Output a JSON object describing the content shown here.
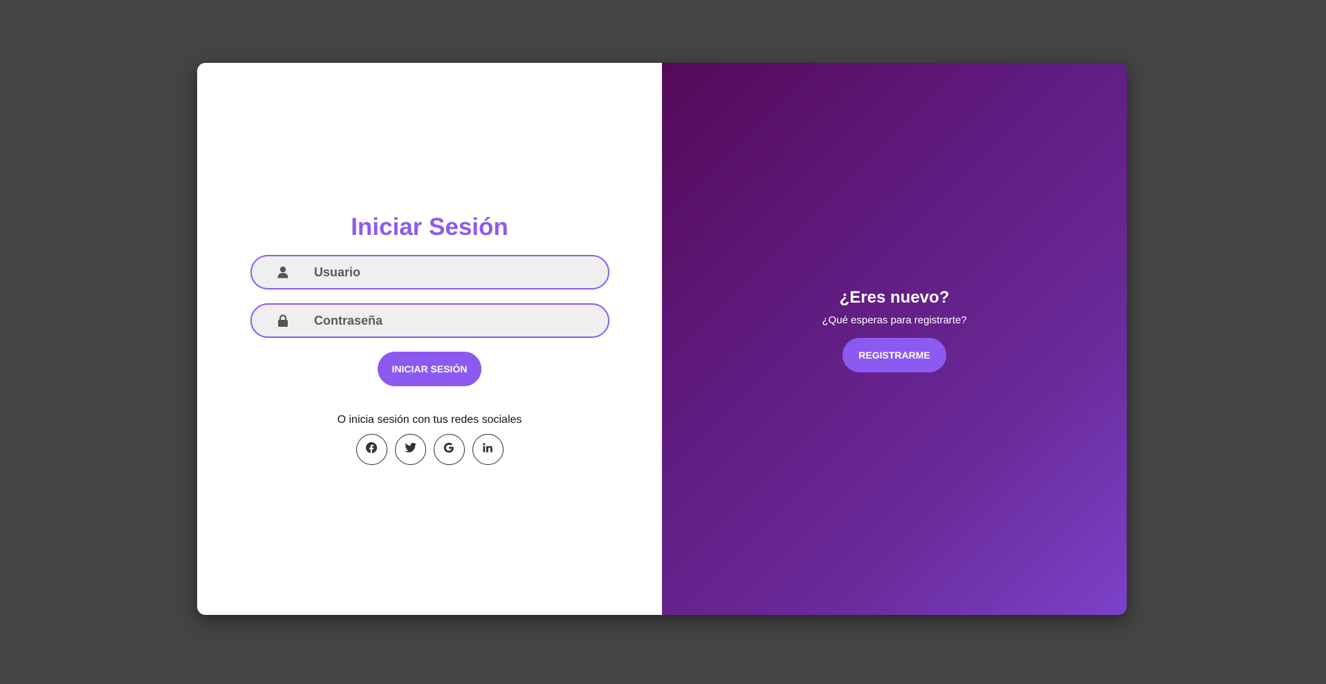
{
  "login": {
    "title": "Iniciar Sesión",
    "username_placeholder": "Usuario",
    "password_placeholder": "Contraseña",
    "submit_label": "INICIAR SESIÓN",
    "social_text": "O inicia sesión con tus redes sociales",
    "socials": [
      {
        "icon": "facebook-icon"
      },
      {
        "icon": "twitter-icon"
      },
      {
        "icon": "google-icon"
      },
      {
        "icon": "linkedin-icon"
      }
    ]
  },
  "register_panel": {
    "title": "¿Eres nuevo?",
    "subtitle": "¿Qué esperas para registrarte?",
    "button_label": "REGISTRARME"
  },
  "colors": {
    "accent": "#8c5af0",
    "background": "#444444",
    "panel_gradient_start": "#540a58",
    "panel_gradient_end": "#7c42c9"
  }
}
